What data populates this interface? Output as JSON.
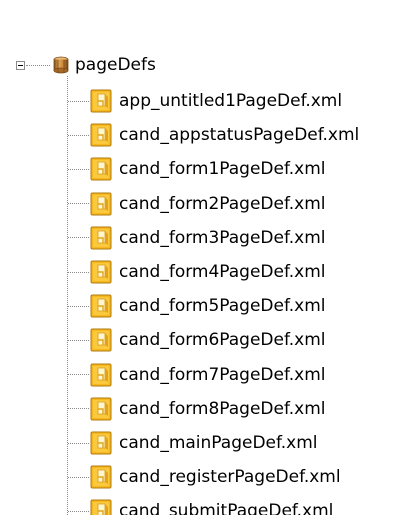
{
  "tree": {
    "root": {
      "label": "pageDefs",
      "icon": "package-icon",
      "expanded": true
    },
    "items": [
      {
        "label": "app_untitled1PageDef.xml",
        "icon": "pagedef-file-icon"
      },
      {
        "label": "cand_appstatusPageDef.xml",
        "icon": "pagedef-file-icon"
      },
      {
        "label": "cand_form1PageDef.xml",
        "icon": "pagedef-file-icon"
      },
      {
        "label": "cand_form2PageDef.xml",
        "icon": "pagedef-file-icon"
      },
      {
        "label": "cand_form3PageDef.xml",
        "icon": "pagedef-file-icon"
      },
      {
        "label": "cand_form4PageDef.xml",
        "icon": "pagedef-file-icon"
      },
      {
        "label": "cand_form5PageDef.xml",
        "icon": "pagedef-file-icon"
      },
      {
        "label": "cand_form6PageDef.xml",
        "icon": "pagedef-file-icon"
      },
      {
        "label": "cand_form7PageDef.xml",
        "icon": "pagedef-file-icon"
      },
      {
        "label": "cand_form8PageDef.xml",
        "icon": "pagedef-file-icon"
      },
      {
        "label": "cand_mainPageDef.xml",
        "icon": "pagedef-file-icon"
      },
      {
        "label": "cand_registerPageDef.xml",
        "icon": "pagedef-file-icon"
      },
      {
        "label": "cand_submitPageDef.xml",
        "icon": "pagedef-file-icon"
      }
    ]
  },
  "colors": {
    "file_icon_fill": "#f7b81e",
    "file_icon_border": "#b07a10",
    "file_icon_paper": "#fff6d0",
    "package_icon_fill": "#c8873a"
  }
}
